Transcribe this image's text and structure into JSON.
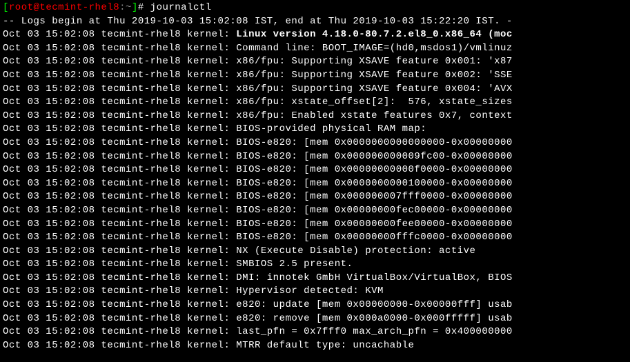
{
  "prompt": {
    "user": "root",
    "at": "@",
    "host": "tecmint-rhel8",
    "cwd": ":~",
    "hash": "# ",
    "command": "journalctl"
  },
  "header": "-- Logs begin at Thu 2019-10-03 15:02:08 IST, end at Thu 2019-10-03 15:22:20 IST. -",
  "lines": [
    {
      "prefix": "Oct 03 15:02:08 tecmint-rhel8 kernel: ",
      "bold": "Linux version 4.18.0-80.7.2.el8_0.x86_64 (moc",
      "rest": ""
    },
    {
      "prefix": "Oct 03 15:02:08 tecmint-rhel8 kernel: ",
      "bold": "",
      "rest": "Command line: BOOT_IMAGE=(hd0,msdos1)/vmlinuz"
    },
    {
      "prefix": "Oct 03 15:02:08 tecmint-rhel8 kernel: ",
      "bold": "",
      "rest": "x86/fpu: Supporting XSAVE feature 0x001: 'x87"
    },
    {
      "prefix": "Oct 03 15:02:08 tecmint-rhel8 kernel: ",
      "bold": "",
      "rest": "x86/fpu: Supporting XSAVE feature 0x002: 'SSE"
    },
    {
      "prefix": "Oct 03 15:02:08 tecmint-rhel8 kernel: ",
      "bold": "",
      "rest": "x86/fpu: Supporting XSAVE feature 0x004: 'AVX"
    },
    {
      "prefix": "Oct 03 15:02:08 tecmint-rhel8 kernel: ",
      "bold": "",
      "rest": "x86/fpu: xstate_offset[2]:  576, xstate_sizes"
    },
    {
      "prefix": "Oct 03 15:02:08 tecmint-rhel8 kernel: ",
      "bold": "",
      "rest": "x86/fpu: Enabled xstate features 0x7, context"
    },
    {
      "prefix": "Oct 03 15:02:08 tecmint-rhel8 kernel: ",
      "bold": "",
      "rest": "BIOS-provided physical RAM map:"
    },
    {
      "prefix": "Oct 03 15:02:08 tecmint-rhel8 kernel: ",
      "bold": "",
      "rest": "BIOS-e820: [mem 0x0000000000000000-0x00000000"
    },
    {
      "prefix": "Oct 03 15:02:08 tecmint-rhel8 kernel: ",
      "bold": "",
      "rest": "BIOS-e820: [mem 0x000000000009fc00-0x00000000"
    },
    {
      "prefix": "Oct 03 15:02:08 tecmint-rhel8 kernel: ",
      "bold": "",
      "rest": "BIOS-e820: [mem 0x00000000000f0000-0x00000000"
    },
    {
      "prefix": "Oct 03 15:02:08 tecmint-rhel8 kernel: ",
      "bold": "",
      "rest": "BIOS-e820: [mem 0x0000000000100000-0x00000000"
    },
    {
      "prefix": "Oct 03 15:02:08 tecmint-rhel8 kernel: ",
      "bold": "",
      "rest": "BIOS-e820: [mem 0x000000007fff0000-0x00000000"
    },
    {
      "prefix": "Oct 03 15:02:08 tecmint-rhel8 kernel: ",
      "bold": "",
      "rest": "BIOS-e820: [mem 0x00000000fec00000-0x00000000"
    },
    {
      "prefix": "Oct 03 15:02:08 tecmint-rhel8 kernel: ",
      "bold": "",
      "rest": "BIOS-e820: [mem 0x00000000fee00000-0x00000000"
    },
    {
      "prefix": "Oct 03 15:02:08 tecmint-rhel8 kernel: ",
      "bold": "",
      "rest": "BIOS-e820: [mem 0x00000000fffc0000-0x00000000"
    },
    {
      "prefix": "Oct 03 15:02:08 tecmint-rhel8 kernel: ",
      "bold": "",
      "rest": "NX (Execute Disable) protection: active"
    },
    {
      "prefix": "Oct 03 15:02:08 tecmint-rhel8 kernel: ",
      "bold": "",
      "rest": "SMBIOS 2.5 present."
    },
    {
      "prefix": "Oct 03 15:02:08 tecmint-rhel8 kernel: ",
      "bold": "",
      "rest": "DMI: innotek GmbH VirtualBox/VirtualBox, BIOS"
    },
    {
      "prefix": "Oct 03 15:02:08 tecmint-rhel8 kernel: ",
      "bold": "",
      "rest": "Hypervisor detected: KVM"
    },
    {
      "prefix": "Oct 03 15:02:08 tecmint-rhel8 kernel: ",
      "bold": "",
      "rest": "e820: update [mem 0x00000000-0x00000fff] usab"
    },
    {
      "prefix": "Oct 03 15:02:08 tecmint-rhel8 kernel: ",
      "bold": "",
      "rest": "e820: remove [mem 0x000a0000-0x000fffff] usab"
    },
    {
      "prefix": "Oct 03 15:02:08 tecmint-rhel8 kernel: ",
      "bold": "",
      "rest": "last_pfn = 0x7fff0 max_arch_pfn = 0x400000000"
    },
    {
      "prefix": "Oct 03 15:02:08 tecmint-rhel8 kernel: ",
      "bold": "",
      "rest": "MTRR default type: uncachable"
    }
  ]
}
